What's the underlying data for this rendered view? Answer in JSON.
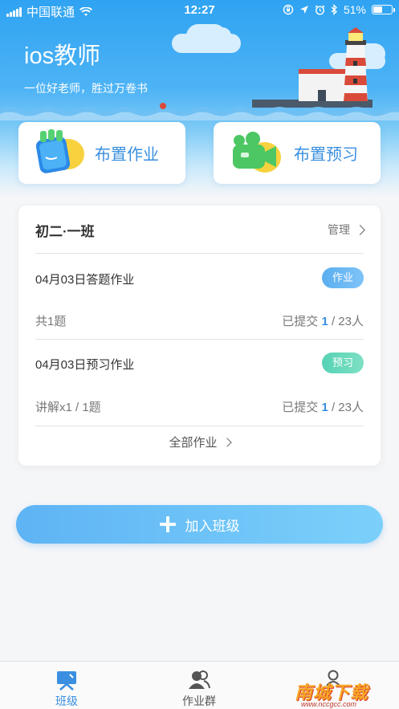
{
  "status_bar": {
    "carrier": "中国联通",
    "time": "12:27",
    "battery": "51%",
    "battery_level": 0.51
  },
  "header": {
    "title": "ios教师",
    "subtitle": "一位好老师，胜过万卷书"
  },
  "actions": {
    "assign_label": "布置作业",
    "preview_label": "布置预习"
  },
  "class_card": {
    "class_name": "初二·一班",
    "manage_label": "管理",
    "assignments": [
      {
        "title": "04月03日答题作业",
        "badge": "作业",
        "detail": "共1题",
        "submitted_prefix": "已提交",
        "submitted_count": "1",
        "submitted_total": "/ 23人"
      },
      {
        "title": "04月03日预习作业",
        "badge": "预习",
        "detail": "讲解x1  / 1题",
        "submitted_prefix": "已提交",
        "submitted_count": "1",
        "submitted_total": "/ 23人"
      }
    ],
    "all_label": "全部作业"
  },
  "join_button": {
    "label": "加入班级"
  },
  "tabbar": {
    "tabs": [
      {
        "label": "班级",
        "icon": "flag-board-icon",
        "active": true
      },
      {
        "label": "作业群",
        "icon": "users-icon",
        "active": false
      },
      {
        "label": "",
        "icon": "person-icon",
        "active": false
      }
    ]
  },
  "watermark": {
    "text": "南城下载",
    "url": "www.nccgcc.com"
  },
  "colors": {
    "accent": "#3a8fe0",
    "header_blue": "#2fa3f2",
    "preview_badge": "#56d2b4",
    "watermark": "#f6a623"
  }
}
